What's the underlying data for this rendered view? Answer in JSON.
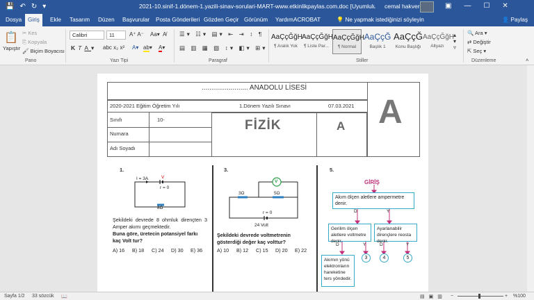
{
  "titlebar": {
    "title": "2021-10.sinif-1.dönem-1.yazili-sinav-sorulari-MART-www.etkinlikpaylas.com.doc [Uyumluluk Modu]  -  Word",
    "user": "cemal hakverdi"
  },
  "menu": {
    "tabs": [
      "Dosya",
      "Giriş",
      "Ekle",
      "Tasarım",
      "Düzen",
      "Başvurular",
      "Posta Gönderileri",
      "Gözden Geçir",
      "Görünüm",
      "Yardım",
      "ACROBAT"
    ],
    "tell_me": "Ne yapmak istediğinizi söyleyin",
    "share": "Paylaş"
  },
  "ribbon": {
    "clipboard": {
      "paste": "Yapıştır",
      "cut": "Kes",
      "copy": "Kopyala",
      "format_painter": "Biçim Boyacısı",
      "label": "Pano"
    },
    "font": {
      "name": "Calibri",
      "size": "11",
      "label": "Yazı Tipi"
    },
    "paragraph": {
      "label": "Paragraf"
    },
    "styles": {
      "label": "Stiller",
      "items": [
        {
          "sample": "AaÇçĞğH",
          "name": "¶ Aralık Yok"
        },
        {
          "sample": "AaÇçĞğH",
          "name": "¶ Liste Par..."
        },
        {
          "sample": "AaÇçĞğH",
          "name": "¶ Normal"
        },
        {
          "sample": "AaÇçĞ",
          "name": "Başlık 1"
        },
        {
          "sample": "AaÇçĞ",
          "name": "Konu Başlığı"
        },
        {
          "sample": "AaÇçĞğH",
          "name": "Altyazı"
        }
      ]
    },
    "editing": {
      "find": "Ara",
      "replace": "Değiştir",
      "select": "Seç",
      "label": "Düzenleme"
    }
  },
  "doc": {
    "school": "........................ ANADOLU LİSESİ",
    "year": "2020-2021 Eğitim Öğretim Yılı",
    "exam": "1.Dönem Yazılı Sınavı",
    "date": "07.03.2021",
    "big_letter": "A",
    "class_label": "Sınıfı",
    "class_value": "10-",
    "number_label": "Numara",
    "name_label": "Adı Soyadı",
    "subject": "FİZİK",
    "booklet": "A",
    "q1": {
      "num": "1.",
      "current": "I = 3A",
      "v": "V",
      "r": "r = 0",
      "res": "8Ω",
      "text": "Şekildeki devrede 8 ohmluk dirençten 3 Amper akımı geçmektedir.",
      "question": "Buna göre, üretecin potansiyel farkı kaç Volt tur?",
      "options": [
        "A) 16",
        "B) 18",
        "C) 24",
        "D) 30",
        "E) 36"
      ]
    },
    "q3": {
      "num": "3.",
      "r1": "3Ω",
      "r2": "5Ω",
      "v": "V",
      "r": "r = 0",
      "emf": "24 Volt",
      "question": "Şekildeki devrede voltmetrenin gösterdiği değer kaç volttur?",
      "options": [
        "A) 10",
        "B) 12",
        "C) 15",
        "D) 20",
        "E) 22"
      ]
    },
    "q5": {
      "num": "5.",
      "start": "GİRİŞ",
      "box1": "Akım ölçen aletlere ampermetre denir.",
      "box2": "Gerilim ölçen aletlere voltmetre denir.",
      "box3": "Ayarlanabilir dirençlere reosta denir.",
      "box4": "Akımın yönü elektronların hareketine ters yöndedir.",
      "d": "D",
      "y": "Y",
      "exits": [
        "3",
        "4",
        "5"
      ]
    }
  },
  "status": {
    "page": "Sayfa 1/2",
    "words": "33 sözcük",
    "zoom": "%100"
  }
}
